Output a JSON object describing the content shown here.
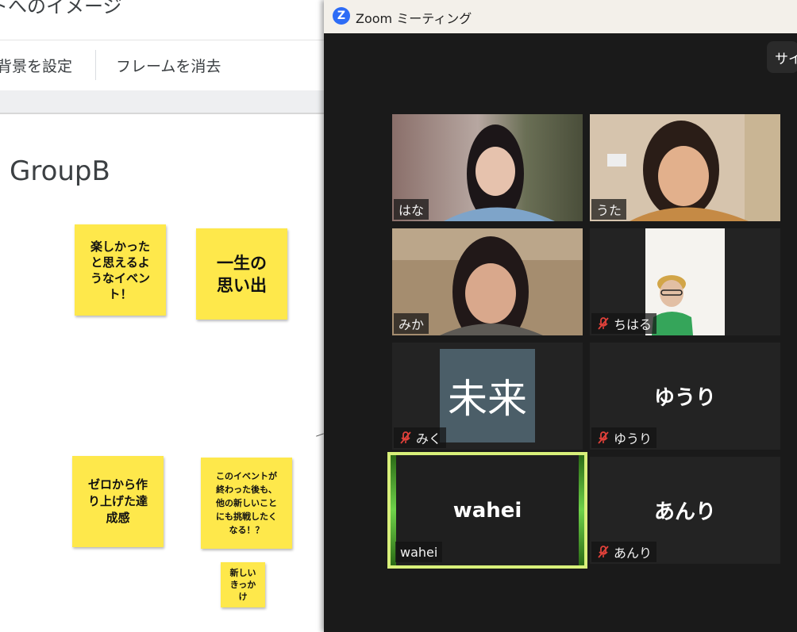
{
  "whiteboard": {
    "title": "トへのイメージ",
    "toolbar": {
      "set_background": "背景を設定",
      "clear_frame": "フレームを消去"
    },
    "group_label": "GroupB",
    "stickies": [
      {
        "text": "楽しかった\nと思えるよ\nうなイベン\nト！"
      },
      {
        "text": "一生の\n思い出"
      },
      {
        "text": "ゼロから作\nり上げた達\n成感"
      },
      {
        "text": "このイベントが\n終わった後も、\n他の新しいこと\nにも挑戦したく\nなる！？"
      },
      {
        "text": "新しい\nきっか\nけ"
      }
    ]
  },
  "zoom": {
    "window_title": "Zoom ミーティング",
    "logo_letter": "Z",
    "side_button_label": "サイ",
    "participants": [
      {
        "name": "はな",
        "muted": false
      },
      {
        "name": "うた",
        "muted": false
      },
      {
        "name": "みか",
        "muted": false
      },
      {
        "name": "ちはる",
        "muted": true
      },
      {
        "name": "みく",
        "muted": true,
        "avatar_text": "未来"
      },
      {
        "name": "ゆうり",
        "muted": true,
        "display_text": "ゆうり"
      },
      {
        "name": "wahei",
        "muted": false,
        "display_text": "wahei",
        "active_speaker": true
      },
      {
        "name": "あんり",
        "muted": true,
        "display_text": "あんり"
      }
    ],
    "colors": {
      "speaker_border": "#d8f07a",
      "mute_red": "#e0413a",
      "background": "#1a1a1a"
    }
  }
}
